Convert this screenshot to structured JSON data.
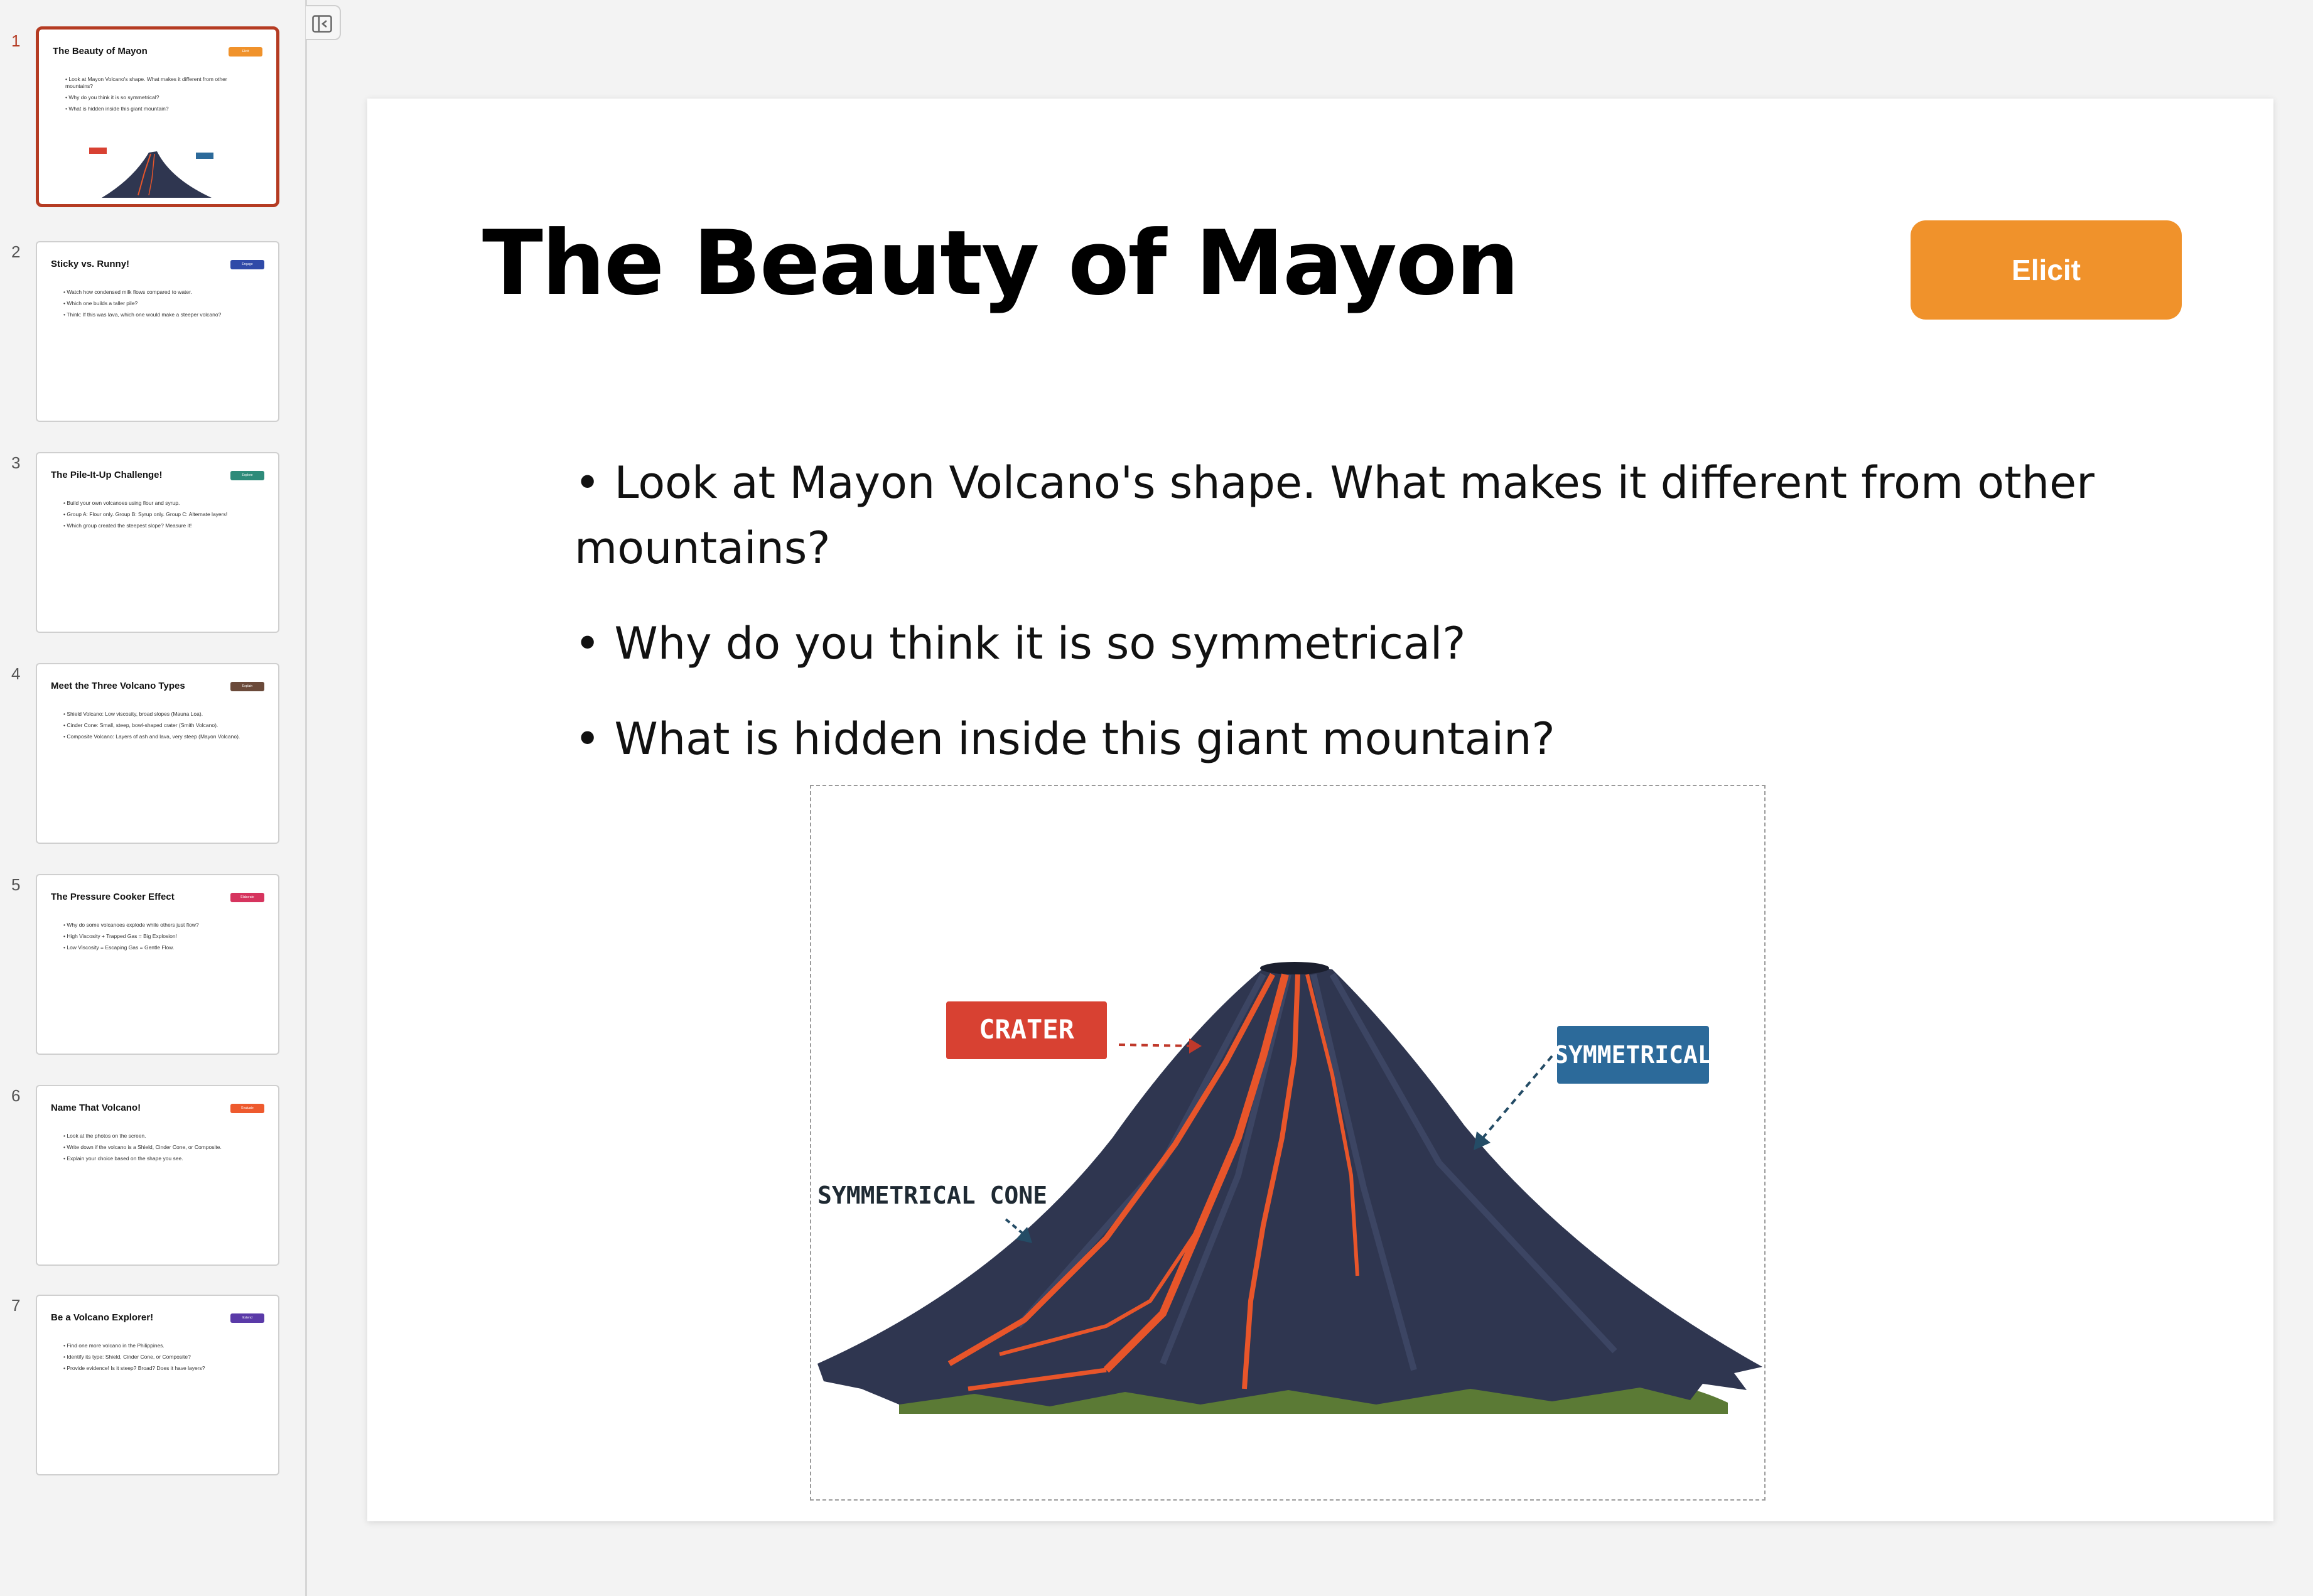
{
  "sidebar": {
    "slides": [
      {
        "number": "1",
        "title": "The Beauty of Mayon",
        "badge": "Elicit",
        "badge_color": "#f0922b",
        "bullets": [
          "Look at Mayon Volcano's shape. What makes it different from other mountains?",
          "Why do you think it is so symmetrical?",
          "What is hidden inside this giant mountain?"
        ]
      },
      {
        "number": "2",
        "title": "Sticky vs. Runny!",
        "badge": "Engage",
        "badge_color": "#2f4aa8",
        "bullets": [
          "Watch how condensed milk flows compared to water.",
          "Which one builds a taller pile?",
          "Think: If this was lava, which one would make a steeper volcano?"
        ]
      },
      {
        "number": "3",
        "title": "The Pile-It-Up Challenge!",
        "badge": "Explore",
        "badge_color": "#2e8b7a",
        "bullets": [
          "Build your own volcanoes using flour and syrup.",
          "Group A: Flour only. Group B: Syrup only. Group C: Alternate layers!",
          "Which group created the steepest slope? Measure it!"
        ]
      },
      {
        "number": "4",
        "title": "Meet the Three Volcano Types",
        "badge": "Explain",
        "badge_color": "#6b4a3a",
        "bullets": [
          "Shield Volcano: Low viscosity, broad slopes (Mauna Loa).",
          "Cinder Cone: Small, steep, bowl-shaped crater (Smith Volcano).",
          "Composite Volcano: Layers of ash and lava, very steep (Mayon Volcano)."
        ]
      },
      {
        "number": "5",
        "title": "The Pressure Cooker Effect",
        "badge": "Elaborate",
        "badge_color": "#d6345e",
        "bullets": [
          "Why do some volcanoes explode while others just flow?",
          "High Viscosity + Trapped Gas = Big Explosion!",
          "Low Viscosity = Escaping Gas = Gentle Flow."
        ]
      },
      {
        "number": "6",
        "title": "Name That Volcano!",
        "badge": "Evaluate",
        "badge_color": "#ee5a2e",
        "bullets": [
          "Look at the photos on the screen.",
          "Write down if the volcano is a Shield, Cinder Cone, or Composite.",
          "Explain your choice based on the shape you see."
        ]
      },
      {
        "number": "7",
        "title": "Be a Volcano Explorer!",
        "badge": "Extend",
        "badge_color": "#5a3aa8",
        "bullets": [
          "Find one more volcano in the Philippines.",
          "Identify its type: Shield, Cinder Cone, or Composite?",
          "Provide evidence! Is it steep? Broad? Does it have layers?"
        ]
      }
    ]
  },
  "slide": {
    "title": "The Beauty of Mayon",
    "tag": "Elicit",
    "bullets": [
      "Look at Mayon Volcano's shape. What makes it different from other mountains?",
      "Why do you think it is so symmetrical?",
      "What is hidden inside this giant mountain?"
    ],
    "image_labels": {
      "crater": "CRATER",
      "symmetrical": "SYMMETRICAL",
      "cone": "SYMMETRICAL CONE"
    }
  },
  "colors": {
    "accent_active": "#b53b22",
    "tag_orange": "#f0922b",
    "crater_red": "#d84132",
    "symmetrical_blue": "#2c6a9a",
    "volcano_body": "#2f3650",
    "lava": "#e8552a"
  },
  "icons": {
    "collapse": "collapse-sidebar-icon"
  }
}
